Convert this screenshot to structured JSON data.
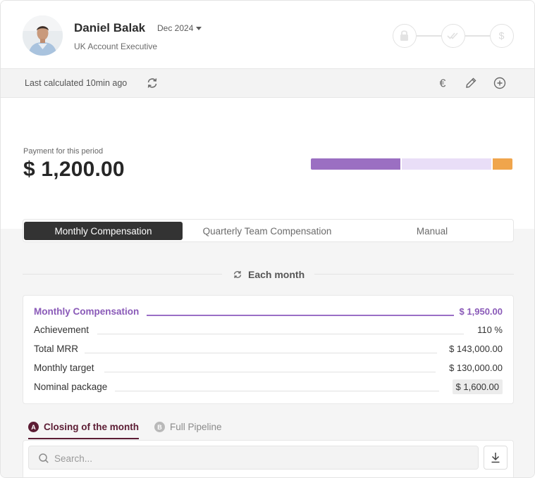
{
  "profile": {
    "name": "Daniel Balak",
    "role": "UK Account Executive",
    "period": "Dec 2024"
  },
  "status_steps": [
    {
      "icon": "lock-icon"
    },
    {
      "icon": "double-check-icon"
    },
    {
      "icon": "dollar-icon"
    }
  ],
  "toolbar": {
    "last_calculated": "Last calculated 10min ago",
    "icons": [
      "refresh-icon",
      "euro-icon",
      "pencil-icon",
      "plus-circle-icon"
    ]
  },
  "payment": {
    "label": "Payment for this period",
    "amount": "$ 1,200.00",
    "bar_segments": [
      {
        "color": "#9b6fc2",
        "fraction": 0.45
      },
      {
        "color": "#e9def7",
        "fraction": 0.45
      },
      {
        "color": "#f0a54c",
        "fraction": 0.1
      }
    ]
  },
  "tabs": [
    {
      "label": "Monthly Compensation",
      "active": true
    },
    {
      "label": "Quarterly Team Compensation",
      "active": false
    },
    {
      "label": "Manual",
      "active": false
    }
  ],
  "frequency": {
    "label": "Each month"
  },
  "breakdown": [
    {
      "label": "Monthly Compensation",
      "value": "$ 1,950.00",
      "total": true
    },
    {
      "label": "Achievement",
      "value": "110 %"
    },
    {
      "label": "Total MRR",
      "value": "$ 143,000.00"
    },
    {
      "label": "Monthly target",
      "value": "$ 130,000.00"
    },
    {
      "label": "Nominal package",
      "value": "$ 1,600.00",
      "boxed": true
    }
  ],
  "subtabs": [
    {
      "badge": "A",
      "label": "Closing of the month",
      "active": true
    },
    {
      "badge": "B",
      "label": "Full Pipeline",
      "active": false
    }
  ],
  "search": {
    "placeholder": "Search...",
    "value": ""
  },
  "colors": {
    "accent_purple": "#8a5ab8",
    "accent_maroon": "#5c1d34",
    "active_tab": "#333333"
  }
}
